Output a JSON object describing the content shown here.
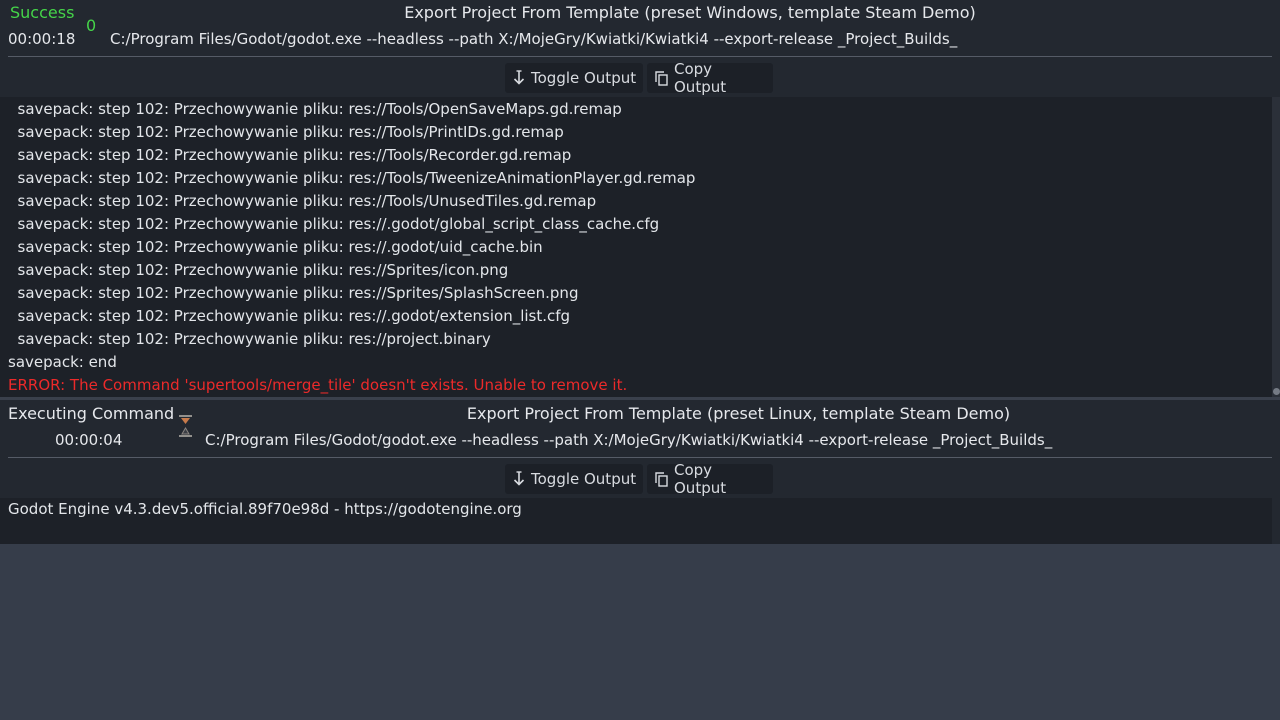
{
  "task1": {
    "status": "Success",
    "exit_code": "0",
    "title": "Export Project From Template (preset Windows, template Steam Demo)",
    "time": "00:00:18",
    "command": "C:/Program Files/Godot/godot.exe --headless --path X:/MojeGry/Kwiatki/Kwiatki4 --export-release _Project_Builds_",
    "toggle_label": "Toggle Output",
    "copy_label": "Copy Output",
    "output_lines": [
      "  savepack: step 102: Przechowywanie pliku: res://Tools/OpenSaveMaps.gd.remap",
      "  savepack: step 102: Przechowywanie pliku: res://Tools/PrintIDs.gd.remap",
      "  savepack: step 102: Przechowywanie pliku: res://Tools/Recorder.gd.remap",
      "  savepack: step 102: Przechowywanie pliku: res://Tools/TweenizeAnimationPlayer.gd.remap",
      "  savepack: step 102: Przechowywanie pliku: res://Tools/UnusedTiles.gd.remap",
      "  savepack: step 102: Przechowywanie pliku: res://.godot/global_script_class_cache.cfg",
      "  savepack: step 102: Przechowywanie pliku: res://.godot/uid_cache.bin",
      "  savepack: step 102: Przechowywanie pliku: res://Sprites/icon.png",
      "  savepack: step 102: Przechowywanie pliku: res://Sprites/SplashScreen.png",
      "  savepack: step 102: Przechowywanie pliku: res://.godot/extension_list.cfg",
      "  savepack: step 102: Przechowywanie pliku: res://project.binary",
      "savepack: end"
    ],
    "error_line": "ERROR: The Command 'supertools/merge_tile' doesn't exists. Unable to remove it."
  },
  "task2": {
    "status": "Executing Command",
    "status_icon": "hourglass-icon",
    "title": "Export Project From Template (preset Linux, template Steam Demo)",
    "time": "00:00:04",
    "command": "C:/Program Files/Godot/godot.exe --headless --path X:/MojeGry/Kwiatki/Kwiatki4 --export-release _Project_Builds_",
    "toggle_label": "Toggle Output",
    "copy_label": "Copy Output",
    "output_lines": [
      "Godot Engine v4.3.dev5.official.89f70e98d - https://godotengine.org"
    ]
  },
  "colors": {
    "success": "#45d449",
    "error": "#ec2a2a",
    "panel_bg": "#232830",
    "output_bg": "#1d2128",
    "page_bg": "#363d4a"
  }
}
